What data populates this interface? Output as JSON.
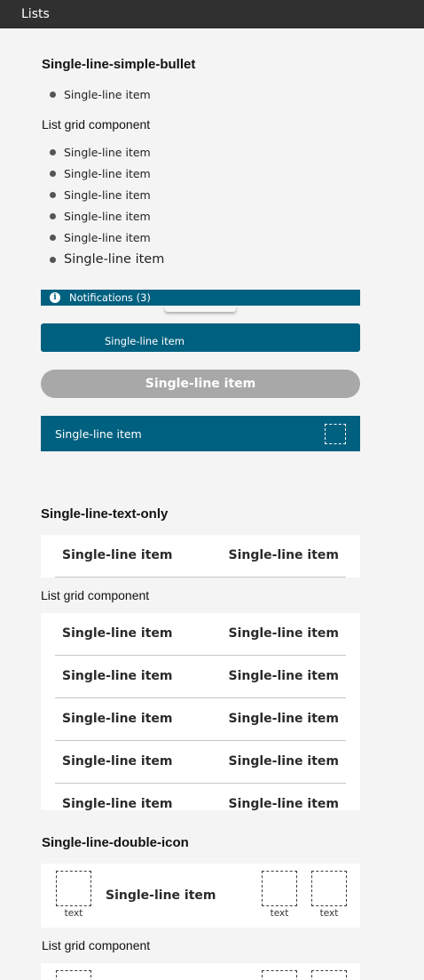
{
  "window": {
    "title": "Lists"
  },
  "section1": {
    "title": "Single-line-simple-bullet",
    "single_item": "Single-line item",
    "grid_label": "List grid component",
    "grid_items": [
      "Single-line item",
      "Single-line item",
      "Single-line item",
      "Single-line item",
      "Single-line item",
      "Single-line item"
    ],
    "notification": {
      "label": "Notifications (3)",
      "icon": "info-icon"
    },
    "blue_button_label": "Single-line item",
    "pill_label": "Single-line item",
    "teal_row_label": "Single-line item"
  },
  "section2": {
    "title": "Single-line-text-only",
    "row": {
      "left": "Single-line item",
      "right": "Single-line item"
    },
    "grid_label": "List grid component",
    "grid_rows": [
      {
        "left": "Single-line item",
        "right": "Single-line item"
      },
      {
        "left": "Single-line item",
        "right": "Single-line item"
      },
      {
        "left": "Single-line item",
        "right": "Single-line item"
      },
      {
        "left": "Single-line item",
        "right": "Single-line item"
      },
      {
        "left": "Single-line item",
        "right": "Single-line item"
      }
    ]
  },
  "section3": {
    "title": "Single-line-double-icon",
    "row": {
      "label": "Single-line item",
      "left_icon_caption": "text",
      "right_icon_caption_1": "text",
      "right_icon_caption_2": "text"
    },
    "grid_label": "List grid component"
  },
  "colors": {
    "accent": "#006080",
    "disabled": "#a8a8a8",
    "titlebar": "#303030",
    "background": "#f4f4f4"
  }
}
